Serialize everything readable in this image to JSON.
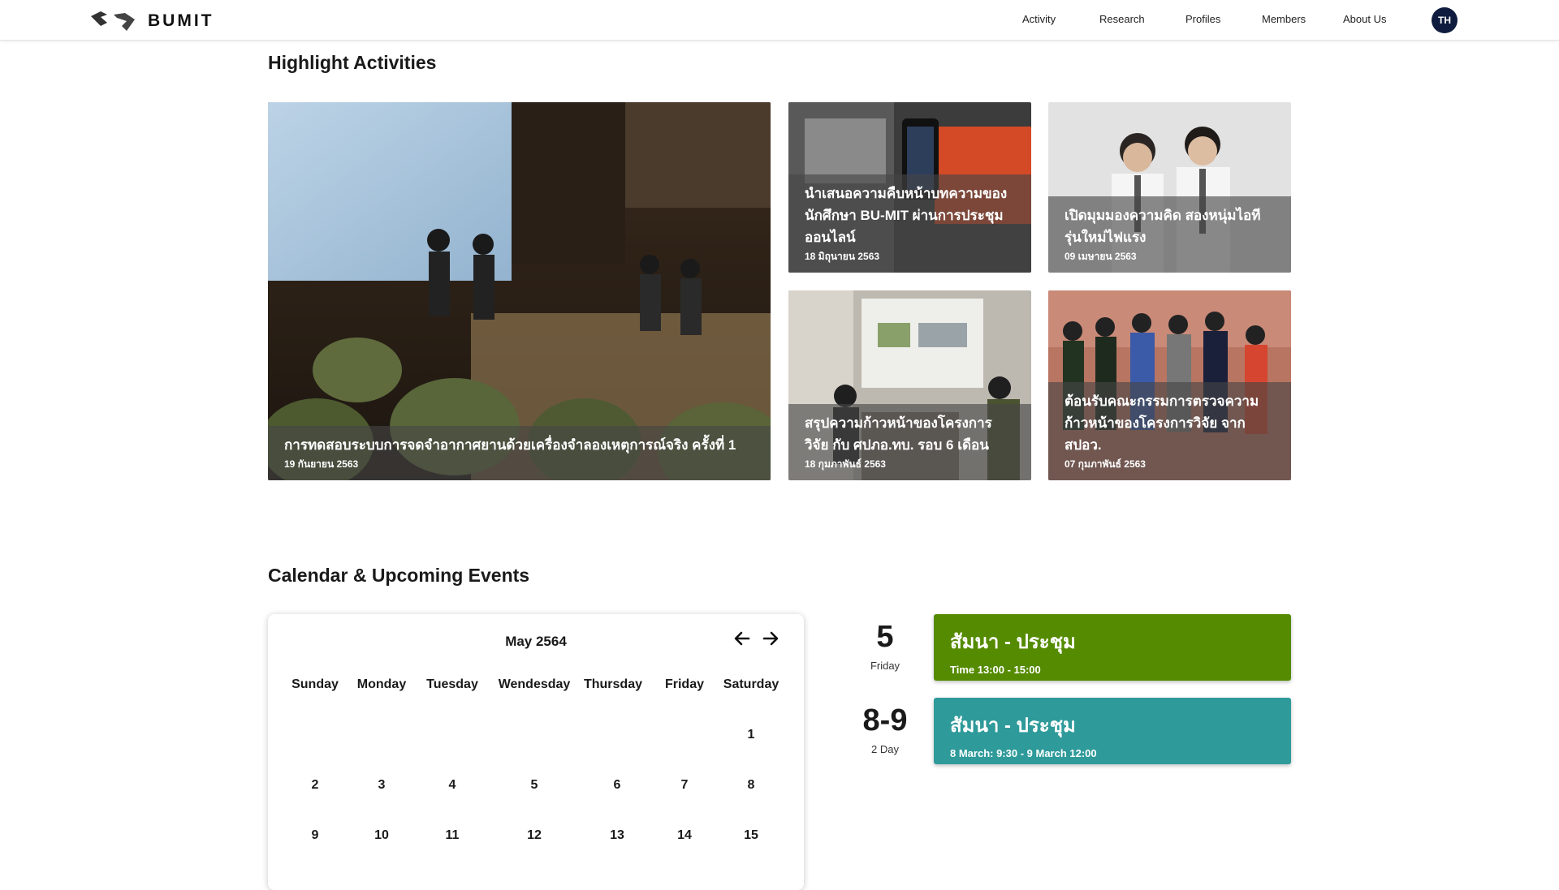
{
  "header": {
    "brand": "BUMIT",
    "nav": [
      "Activity",
      "Research",
      "Profiles",
      "Members",
      "About Us"
    ],
    "lang": "TH"
  },
  "highlights": {
    "title": "Highlight Activities",
    "items": [
      {
        "title": "การทดสอบระบบการจดจำอากาศยานด้วยเครื่องจำลองเหตุการณ์จริง ครั้งที่ 1",
        "date": "19 กันยายน 2563"
      },
      {
        "title": "นำเสนอความคืบหน้าบทความของนักศึกษา BU-MIT ผ่านการประชุมออนไลน์",
        "date": "18 มิถุนายน 2563"
      },
      {
        "title": "เปิดมุมมองความคิด สองหนุ่มไอทีรุ่นใหม่ไฟแรง",
        "date": "09 เมษายน 2563"
      },
      {
        "title": "สรุปความก้าวหน้าของโครงการวิจัย กับ ศปภอ.ทบ. รอบ 6 เดือน",
        "date": "18 กุมภาพันธ์ 2563"
      },
      {
        "title": "ต้อนรับคณะกรรมการตรวจความก้าวหน้าของโครงการวิจัย จาก สปอว.",
        "date": "07 กุมภาพันธ์ 2563"
      }
    ]
  },
  "calendar_section": {
    "title": "Calendar & Upcoming Events",
    "month": "May 2564",
    "weekdays": [
      "Sunday",
      "Monday",
      "Tuesday",
      "Wendesday",
      "Thursday",
      "Friday",
      "Saturday"
    ],
    "weeks": [
      [
        "",
        "",
        "",
        "",
        "",
        "",
        "1"
      ],
      [
        "2",
        "3",
        "4",
        "5",
        "6",
        "7",
        "8"
      ],
      [
        "9",
        "10",
        "11",
        "12",
        "13",
        "14",
        "15"
      ]
    ]
  },
  "events": [
    {
      "day": "5",
      "sub": "Friday",
      "title": "สัมนา - ประชุม",
      "time": "Time 13:00 - 15:00",
      "color": "#558b00"
    },
    {
      "day": "8-9",
      "sub": "2 Day",
      "title": "สัมนา - ประชุม",
      "time": "8 March: 9:30 - 9 March 12:00",
      "color": "#2f9a9a"
    }
  ]
}
